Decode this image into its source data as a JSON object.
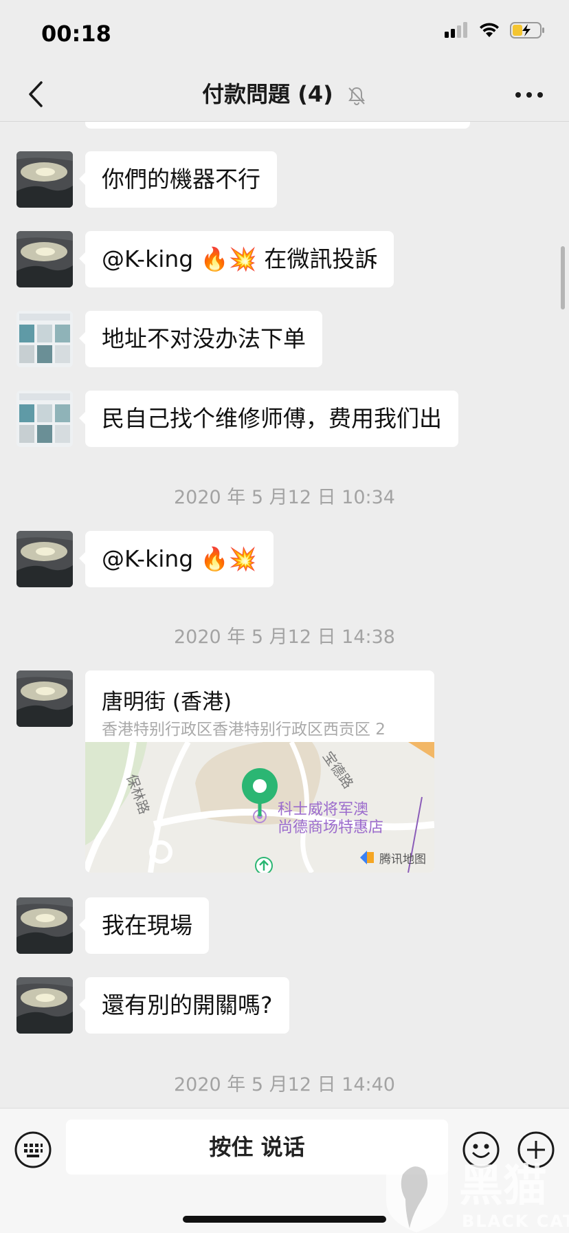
{
  "status_bar": {
    "time": "00:18"
  },
  "nav": {
    "title": "付款問題 (4)"
  },
  "messages": [
    {
      "text": "你們的機器不行"
    },
    {
      "text": "@K-king 🔥💥 在微訊投訴"
    },
    {
      "text": "地址不对没办法下单"
    },
    {
      "text": "民自己找个维修师傅，费用我们出"
    },
    {
      "text": "@K-king 🔥💥"
    },
    {
      "text": "我在現場"
    },
    {
      "text": "還有別的開關嗎?"
    }
  ],
  "timestamps": [
    "2020 年 5 月12 日 10:34",
    "2020 年 5 月12 日 14:38",
    "2020 年 5 月12 日 14:40"
  ],
  "location": {
    "name": "唐明街 (香港)",
    "address": "香港特别行政区香港特别行政区西贡区 2",
    "map": {
      "poi_line1": "科士威将军澳",
      "poi_line2": "尚德商场特惠店",
      "road1": "保林路",
      "road2": "宝德路",
      "provider": "腾讯地图"
    }
  },
  "input_bar": {
    "hold_to_talk": "按住 说话"
  },
  "watermark": {
    "cn": "黑猫",
    "en": "BLACK CAT"
  }
}
